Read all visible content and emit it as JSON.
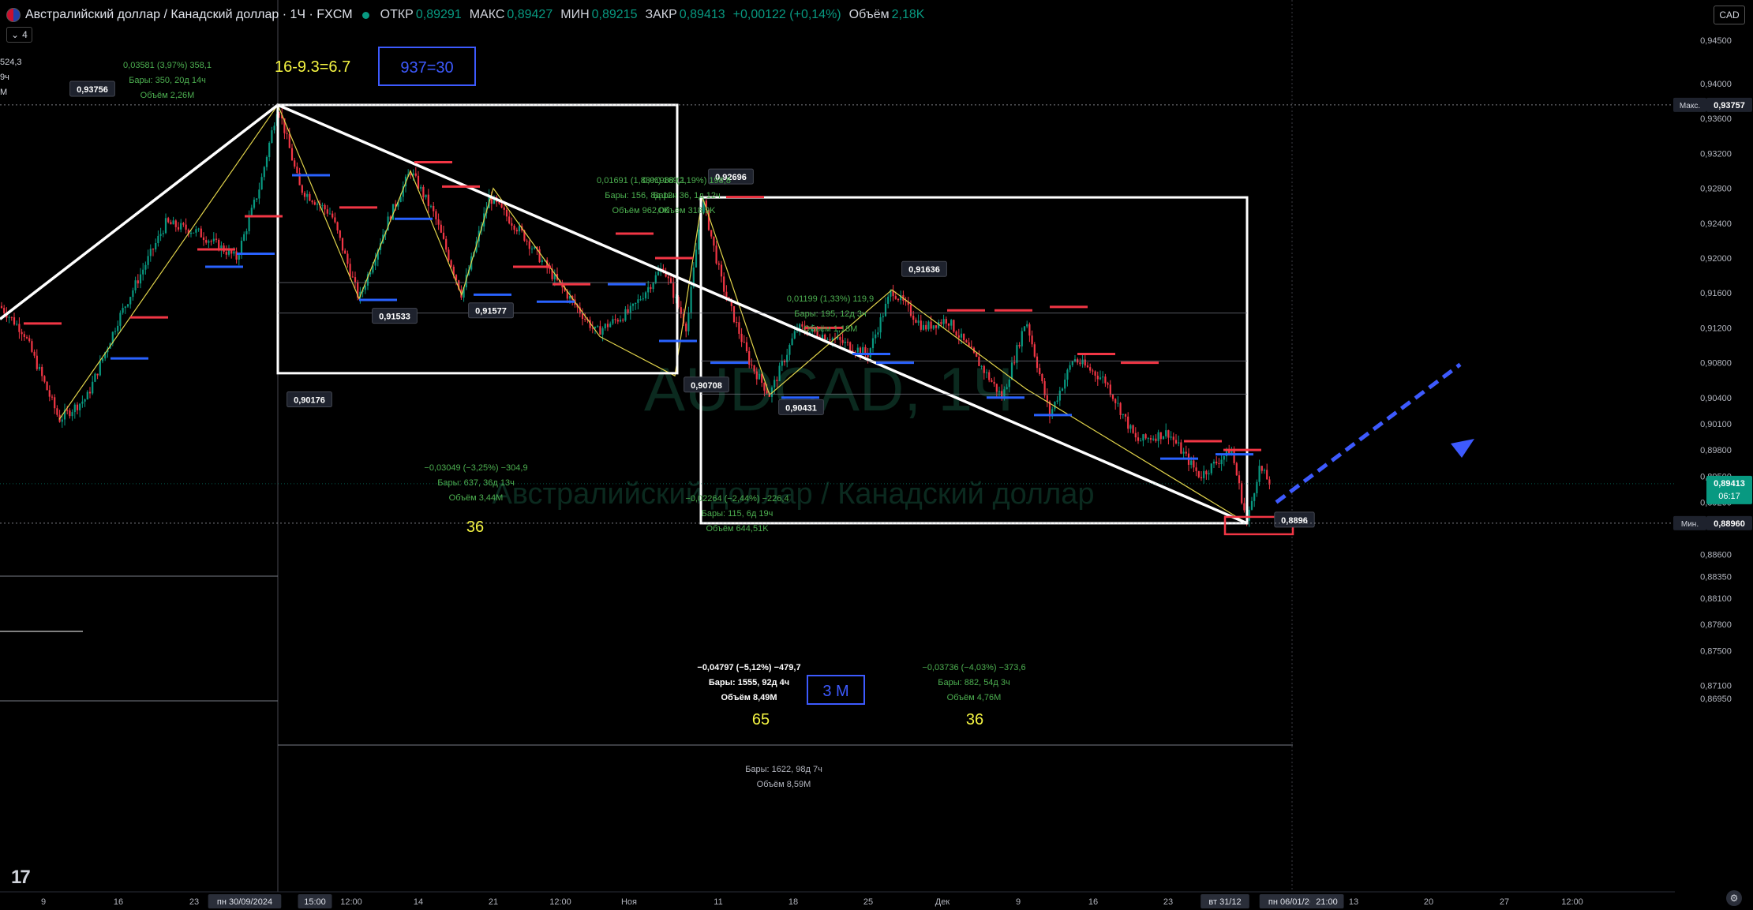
{
  "header": {
    "title": "Австралийский доллар / Канадский доллар · 1Ч · FXCM",
    "open_label": "ОТКР",
    "open": "0,89291",
    "high_label": "МАКС",
    "high": "0,89427",
    "low_label": "МИН",
    "low": "0,89215",
    "close_label": "ЗАКР",
    "close": "0,89413",
    "change": "+0,00122 (+0,14%)",
    "volume_label": "Объём",
    "volume": "2,18K",
    "indicator_count": "4",
    "currency": "CAD",
    "tv_logo": "17"
  },
  "chart_data": {
    "type": "candlestick",
    "symbol": "AUDCAD",
    "timeframe": "1Ч",
    "ylim": [
      0.8686,
      0.9468
    ],
    "price_ticks": [
      "0,94500",
      "0,94000",
      "0,93600",
      "0,93200",
      "0,92800",
      "0,92400",
      "0,92000",
      "0,91600",
      "0,91200",
      "0,90800",
      "0,90400",
      "0,90100",
      "0,89800",
      "0,89500",
      "0,89200",
      "0,88960",
      "0,88600",
      "0,88350",
      "0,88100",
      "0,87800",
      "0,87500",
      "0,87100",
      "0,86950"
    ],
    "time_ticks": [
      "9",
      "16",
      "23",
      "пн 30/09/2024",
      "15:00",
      "12:00",
      "14",
      "21",
      "12:00",
      "Ноя",
      "11",
      "18",
      "25",
      "Дек",
      "9",
      "16",
      "23",
      "вт 31/12",
      "пн 06/01/2025",
      "21:00",
      "13",
      "20",
      "27",
      "12:00"
    ],
    "axis_markers": {
      "max_label": "Макс.",
      "max_value": "0,93757",
      "min_label": "Мин.",
      "min_value": "0,88960",
      "last_price": "0,89413",
      "last_countdown": "06:17"
    },
    "pivots": [
      {
        "label": "0,93756",
        "price": 0.93756
      },
      {
        "label": "0,90176",
        "price": 0.90176
      },
      {
        "label": "0,91533",
        "price": 0.91533
      },
      {
        "label": "0,91577",
        "price": 0.91577
      },
      {
        "label": "0,92696",
        "price": 0.92696
      },
      {
        "label": "0,90708",
        "price": 0.90708
      },
      {
        "label": "0,90431",
        "price": 0.90431
      },
      {
        "label": "0,91636",
        "price": 0.91636
      },
      {
        "label": "0,8896",
        "price": 0.8896
      }
    ],
    "stats": [
      [
        "524,3",
        "9ч",
        "M"
      ],
      [
        "0,03581 (3,97%) 358,1",
        "Бары: 350, 20д 14ч",
        "Объём 2,26M"
      ],
      [
        "0,01691 (1,83%) 169,1",
        "Бары: 156, 8д 12ч",
        "Объём 962,0K"
      ],
      [
        "0,01988 (2,19%) 198,8",
        "Бары: 36, 1д 12ч",
        "Объём 318,9K"
      ],
      [
        "−0,03049 (−3,25%) −304,9",
        "Бары: 637, 36д 13ч",
        "Объём 3,44M"
      ],
      [
        "0,01199 (1,33%) 119,9",
        "Бары: 195, 12д 3ч",
        "Объём 1,18M"
      ],
      [
        "−0,02264 (−2,44%) −226,4",
        "Бары: 115, 6д 19ч",
        "Объём 644,51K"
      ],
      [
        "−0,04797 (−5,12%) −479,7",
        "Бары: 1555, 92д 4ч",
        "Объём 8,49M"
      ],
      [
        "−0,03736 (−4,03%) −373,6",
        "Бары: 882, 54д 3ч",
        "Объём 4,76M"
      ],
      [
        "Бары: 1622, 98д 7ч",
        "Объём 8,59M"
      ]
    ],
    "annotations": [
      "16-9.3=6.7",
      "937=30",
      "36",
      "65",
      "36",
      "3 M"
    ],
    "watermark": [
      "AUDCAD, 1Ч",
      "Австралийский доллар / Канадский доллар"
    ],
    "colors": {
      "up": "#089981",
      "down": "#f23645",
      "bg": "#000000",
      "projection": "#3d5afe",
      "label_yellow": "#f5f542"
    }
  }
}
